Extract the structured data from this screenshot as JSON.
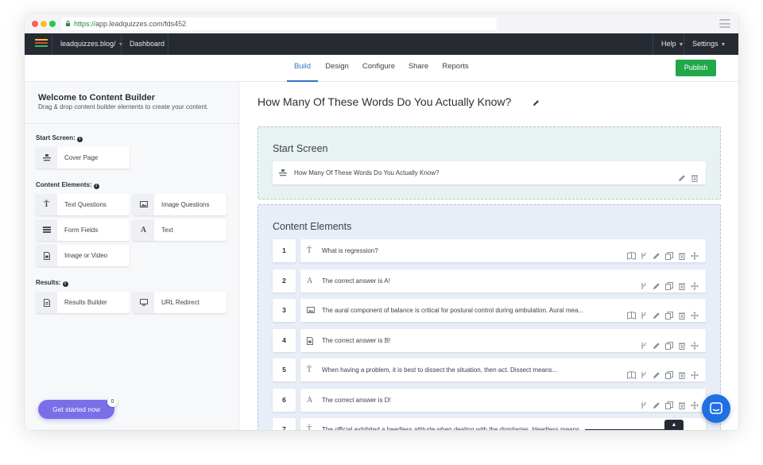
{
  "browser": {
    "url_scheme": "https://",
    "url_rest": "app.leadquizzes.com/fds452"
  },
  "topnav": {
    "site": "leadquizzes.blog/",
    "dashboard": "Dashboard",
    "help": "Help",
    "settings": "Settings"
  },
  "tabs": [
    {
      "label": "Build",
      "active": true
    },
    {
      "label": "Design"
    },
    {
      "label": "Configure"
    },
    {
      "label": "Share"
    },
    {
      "label": "Reports"
    }
  ],
  "publish_label": "Publish",
  "sidebar": {
    "title": "Welcome to Content Builder",
    "subtitle": "Drag & drop content builder elements to create your content.",
    "start_screen_label": "Start Screen:",
    "start_items": [
      {
        "label": "Cover Page",
        "icon": "cover-page-icon"
      }
    ],
    "content_label": "Content Elements:",
    "content_items": [
      {
        "label": "Text Questions",
        "icon": "text-question-icon"
      },
      {
        "label": "Image Questions",
        "icon": "image-question-icon"
      },
      {
        "label": "Form Fields",
        "icon": "form-fields-icon"
      },
      {
        "label": "Text",
        "icon": "text-icon"
      },
      {
        "label": "Image or Video",
        "icon": "image-video-icon"
      }
    ],
    "results_label": "Results:",
    "results_items": [
      {
        "label": "Results Builder",
        "icon": "results-builder-icon"
      },
      {
        "label": "URL Redirect",
        "icon": "url-redirect-icon"
      }
    ],
    "get_started": "Get started now",
    "get_started_badge": "0"
  },
  "main": {
    "quiz_title": "How Many Of These Words Do You Actually Know?",
    "start_screen_title": "Start Screen",
    "start_screen_item": "How Many Of These Words Do You Actually Know?",
    "content_title": "Content Elements",
    "rows": [
      {
        "num": "1",
        "icon": "text-question-icon",
        "text": "What is regression?"
      },
      {
        "num": "2",
        "icon": "text-icon",
        "text": "The correct answer is A!"
      },
      {
        "num": "3",
        "icon": "image-question-icon",
        "text": "The aural component of balance is critical for postural control during ambulation. Aural mea..."
      },
      {
        "num": "4",
        "icon": "image-video-icon",
        "text": "The correct answer is B!"
      },
      {
        "num": "5",
        "icon": "text-question-icon",
        "text": "When having a problem, it is best to dissect the situation, then act. Dissect means..."
      },
      {
        "num": "6",
        "icon": "text-icon",
        "text": "The correct answer is D!"
      },
      {
        "num": "7",
        "icon": "text-question-icon",
        "text": "The official exhibited a heedless attitude when dealing with the dignitaries. Heedless means..."
      }
    ]
  },
  "colors": {
    "accent": "#2e76c7",
    "publish": "#21a84a",
    "nav": "#252a33",
    "get_started": "#7b6fe8",
    "chat": "#1f6fe5"
  }
}
